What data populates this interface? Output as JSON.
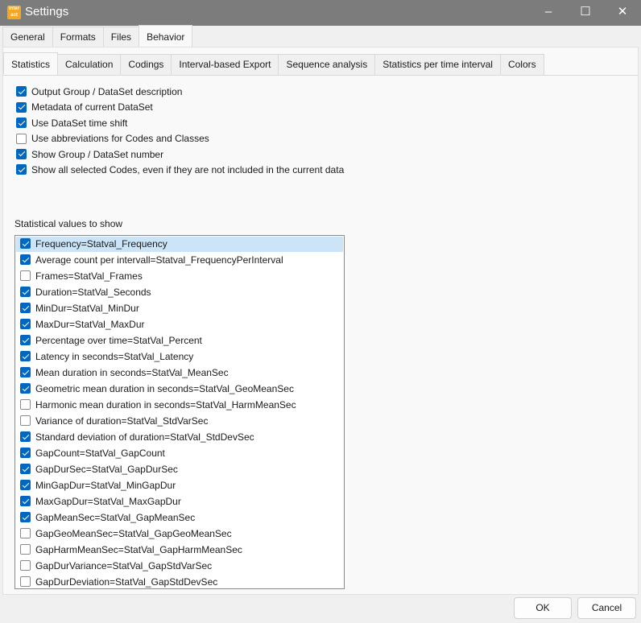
{
  "window": {
    "title": "Settings",
    "logo_text": "inter act"
  },
  "top_tabs": [
    {
      "label": "General"
    },
    {
      "label": "Formats"
    },
    {
      "label": "Files"
    },
    {
      "label": "Behavior",
      "active": true
    }
  ],
  "sub_tabs": [
    {
      "label": "Statistics",
      "active": true
    },
    {
      "label": "Calculation"
    },
    {
      "label": "Codings"
    },
    {
      "label": "Interval-based Export"
    },
    {
      "label": "Sequence analysis"
    },
    {
      "label": "Statistics per time interval"
    },
    {
      "label": "Colors"
    }
  ],
  "options": [
    {
      "label": "Output Group / DataSet description",
      "checked": true
    },
    {
      "label": "Metadata of current DataSet",
      "checked": true
    },
    {
      "label": "Use DataSet time shift",
      "checked": true
    },
    {
      "label": "Use abbreviations for Codes and Classes",
      "checked": false
    },
    {
      "label": "Show Group / DataSet number",
      "checked": true
    },
    {
      "label": "Show all selected Codes, even if they are not included in the current data",
      "checked": true
    }
  ],
  "stat_label": "Statistical values to show",
  "stat_values": [
    {
      "label": "Frequency=Statval_Frequency",
      "checked": true,
      "selected": true
    },
    {
      "label": "Average count per intervall=Statval_FrequencyPerInterval",
      "checked": true
    },
    {
      "label": "Frames=StatVal_Frames",
      "checked": false
    },
    {
      "label": "Duration=StatVal_Seconds",
      "checked": true
    },
    {
      "label": "MinDur=StatVal_MinDur",
      "checked": true
    },
    {
      "label": "MaxDur=StatVal_MaxDur",
      "checked": true
    },
    {
      "label": "Percentage over time=StatVal_Percent",
      "checked": true
    },
    {
      "label": "Latency in seconds=StatVal_Latency",
      "checked": true
    },
    {
      "label": "Mean duration in seconds=StatVal_MeanSec",
      "checked": true
    },
    {
      "label": "Geometric mean duration in seconds=StatVal_GeoMeanSec",
      "checked": true
    },
    {
      "label": "Harmonic mean duration in seconds=StatVal_HarmMeanSec",
      "checked": false
    },
    {
      "label": "Variance of duration=StatVal_StdVarSec",
      "checked": false
    },
    {
      "label": "Standard deviation of duration=StatVal_StdDevSec",
      "checked": true
    },
    {
      "label": "GapCount=StatVal_GapCount",
      "checked": true
    },
    {
      "label": "GapDurSec=StatVal_GapDurSec",
      "checked": true
    },
    {
      "label": "MinGapDur=StatVal_MinGapDur",
      "checked": true
    },
    {
      "label": "MaxGapDur=StatVal_MaxGapDur",
      "checked": true
    },
    {
      "label": "GapMeanSec=StatVal_GapMeanSec",
      "checked": true
    },
    {
      "label": "GapGeoMeanSec=StatVal_GapGeoMeanSec",
      "checked": false
    },
    {
      "label": "GapHarmMeanSec=StatVal_GapHarmMeanSec",
      "checked": false
    },
    {
      "label": "GapDurVariance=StatVal_GapStdVarSec",
      "checked": false
    },
    {
      "label": "GapDurDeviation=StatVal_GapStdDevSec",
      "checked": false
    }
  ],
  "buttons": {
    "ok": "OK",
    "cancel": "Cancel"
  },
  "colors": {
    "accent": "#0067c0",
    "selection": "#cce4f7",
    "titlebar": "#7c7c7c"
  }
}
